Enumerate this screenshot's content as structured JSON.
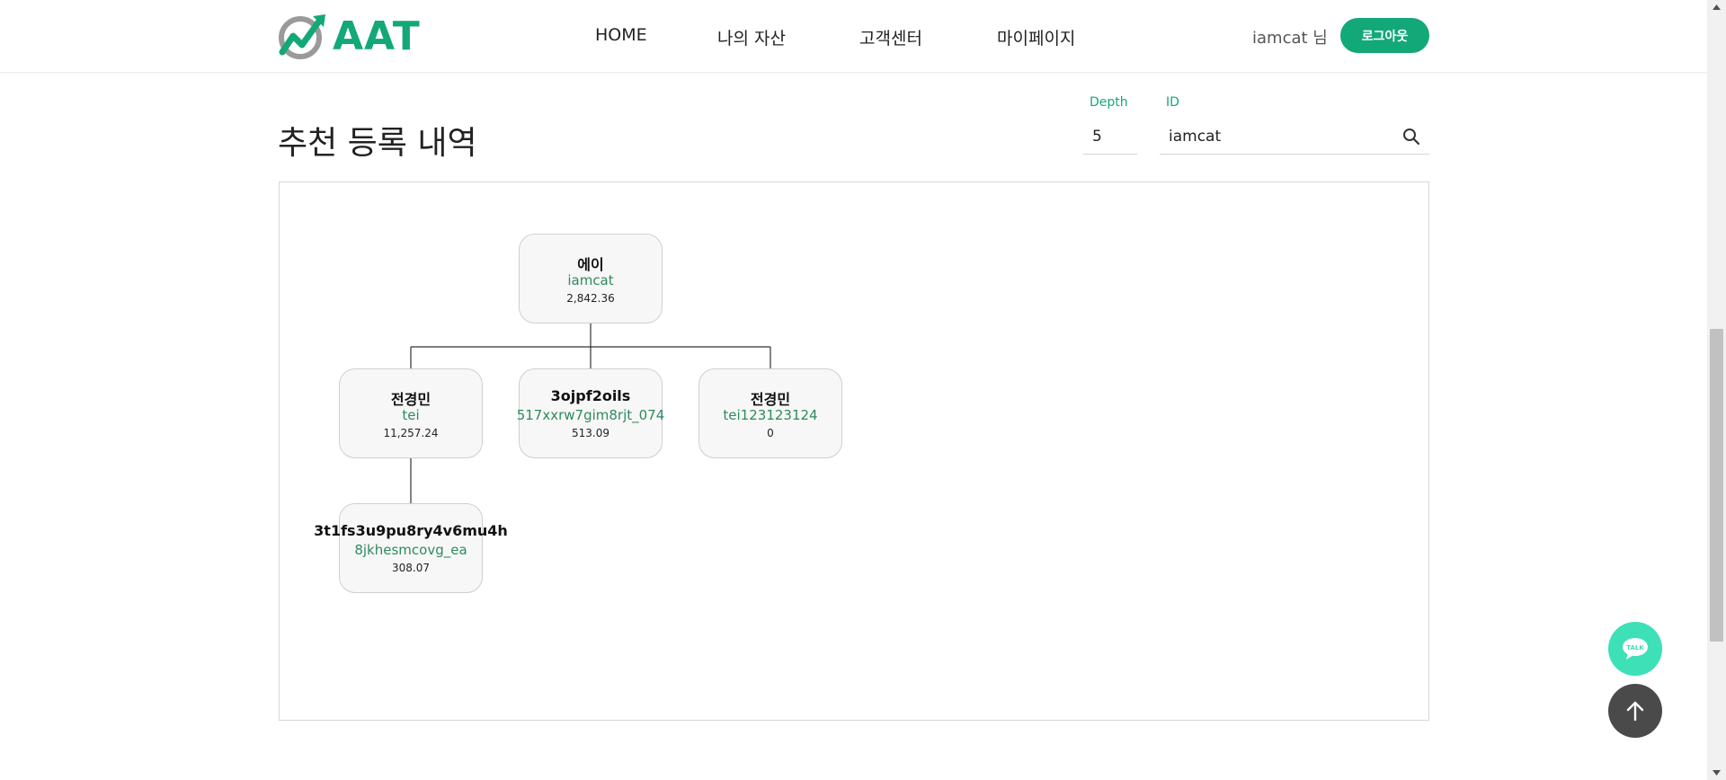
{
  "brand": {
    "name": "AAT",
    "accent_color": "#13a877"
  },
  "nav": {
    "items": [
      {
        "label": "HOME"
      },
      {
        "label": "나의 자산"
      },
      {
        "label": "고객센터"
      },
      {
        "label": "마이페이지"
      }
    ]
  },
  "user": {
    "greeting": "iamcat 님",
    "logout_label": "로그아웃"
  },
  "page": {
    "title": "추천 등록 내역"
  },
  "filters": {
    "depth": {
      "label": "Depth",
      "value": "5"
    },
    "id": {
      "label": "ID",
      "value": "iamcat",
      "icon": "search-icon"
    }
  },
  "tree": {
    "nodes": [
      {
        "name": "에이",
        "id": "iamcat",
        "amount": "2,842.36"
      },
      {
        "name": "전경민",
        "id": "tei",
        "amount": "11,257.24"
      },
      {
        "name": "3ojpf2oils",
        "id": "517xxrw7gim8rjt_074",
        "amount": "513.09"
      },
      {
        "name": "전경민",
        "id": "tei123123124",
        "amount": "0"
      },
      {
        "name": "3t1fs3u9pu8ry4v6mu4h",
        "id": "8jkhesmcovg_ea",
        "amount": "308.07"
      }
    ],
    "edges": [
      [
        0,
        1
      ],
      [
        0,
        2
      ],
      [
        0,
        3
      ],
      [
        1,
        4
      ]
    ]
  },
  "floating": {
    "talk_label": "TALK",
    "talk_icon": "chat-bubble-icon",
    "top_icon": "arrow-up-icon"
  }
}
